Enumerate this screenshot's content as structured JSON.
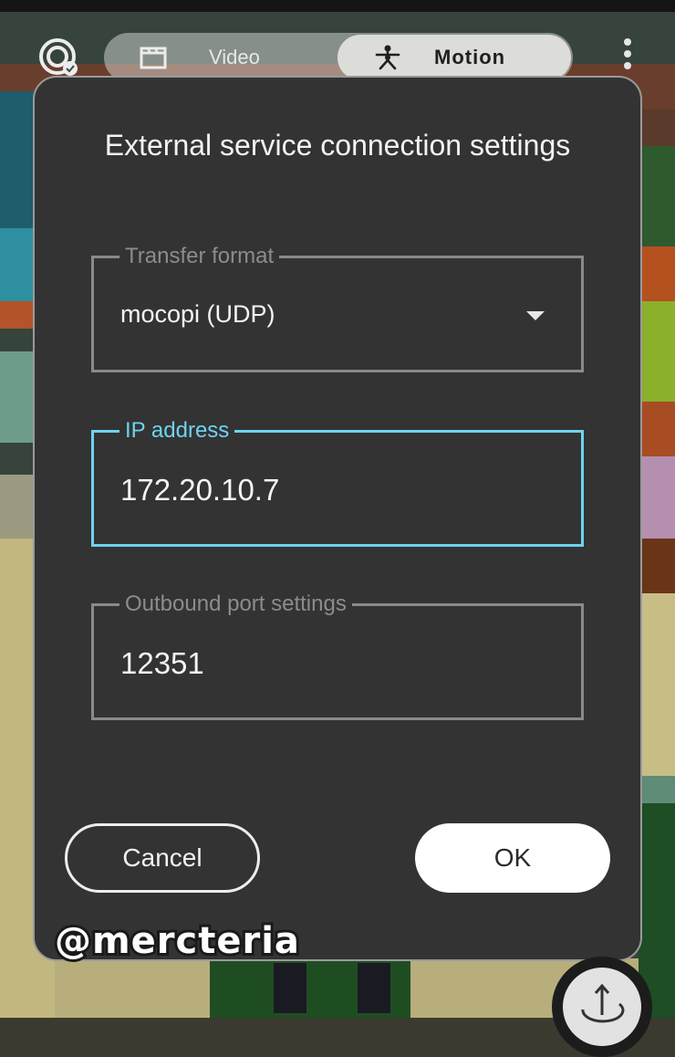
{
  "top_bar": {
    "record_icon": "record-check-icon",
    "tabs": [
      {
        "label": "Video",
        "icon": "clapperboard-icon",
        "selected": false
      },
      {
        "label": "Motion",
        "icon": "skeleton-figure-icon",
        "selected": true
      }
    ],
    "menu_icon": "more-vertical-icon"
  },
  "dialog": {
    "title": "External service connection settings",
    "transfer_format": {
      "label": "Transfer format",
      "value": "mocopi (UDP)"
    },
    "ip_address": {
      "label": "IP address",
      "value": "172.20.10.7"
    },
    "port": {
      "label": "Outbound port settings",
      "value": "12351"
    },
    "cancel_label": "Cancel",
    "ok_label": "OK"
  },
  "watermark": "@mercteria",
  "colors": {
    "dialog_bg": "#333333",
    "focus_accent": "#6fd3ef",
    "field_border": "#8a8a8a"
  }
}
